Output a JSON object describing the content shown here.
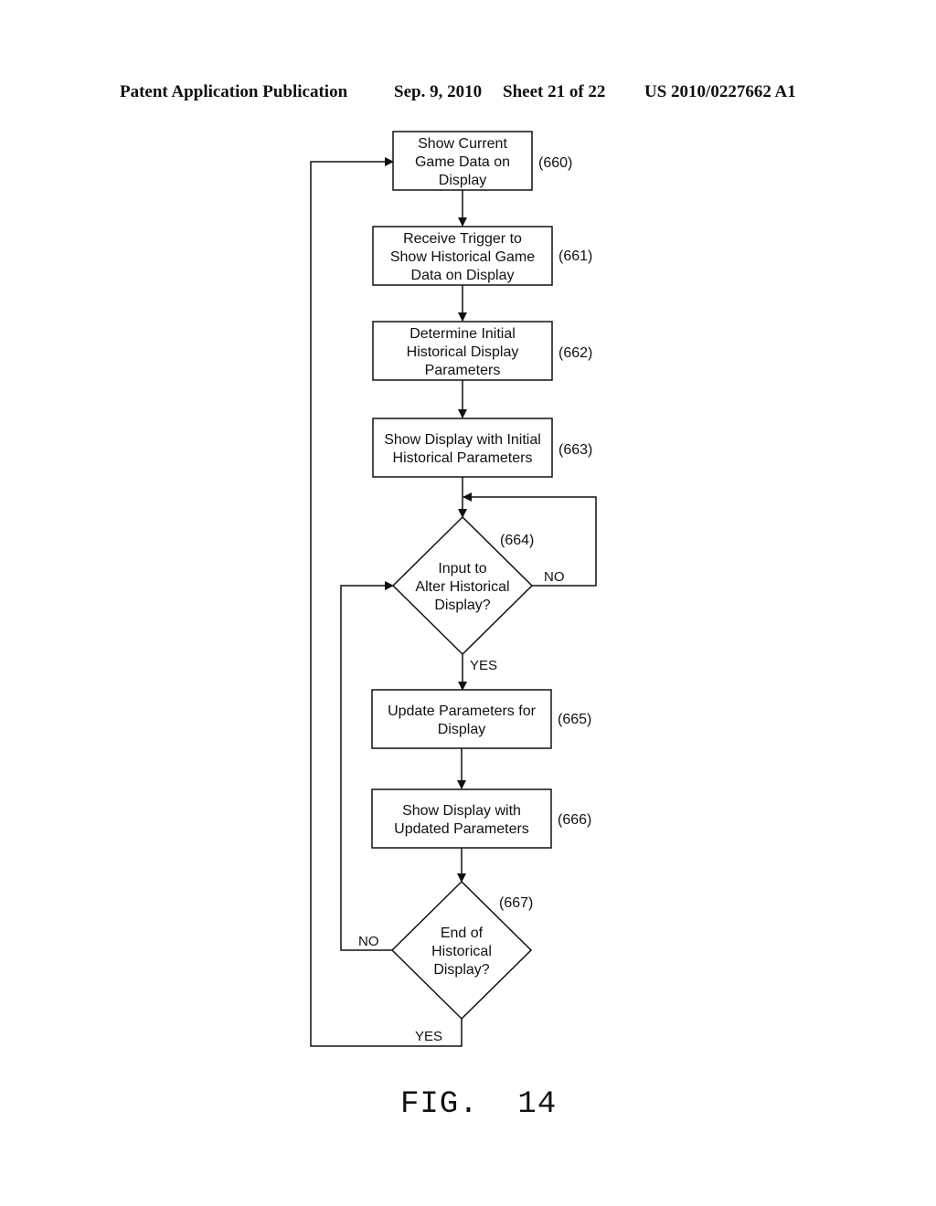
{
  "header": {
    "publication": "Patent Application Publication",
    "date": "Sep. 9, 2010",
    "sheet": "Sheet 21 of 22",
    "number": "US 2010/0227662 A1"
  },
  "figure_label": "FIG.  14",
  "nodes": [
    {
      "id": "660",
      "type": "process",
      "lines": [
        "Show Current",
        "Game Data on",
        "Display"
      ],
      "ref": "(660)"
    },
    {
      "id": "661",
      "type": "process",
      "lines": [
        "Receive Trigger to",
        "Show Historical Game",
        "Data on Display"
      ],
      "ref": "(661)"
    },
    {
      "id": "662",
      "type": "process",
      "lines": [
        "Determine Initial",
        "Historical Display",
        "Parameters"
      ],
      "ref": "(662)"
    },
    {
      "id": "663",
      "type": "process",
      "lines": [
        "Show Display with Initial",
        "Historical Parameters"
      ],
      "ref": "(663)"
    },
    {
      "id": "664",
      "type": "decision",
      "lines": [
        "Input to",
        "Alter Historical",
        "Display?"
      ],
      "ref": "(664)"
    },
    {
      "id": "665",
      "type": "process",
      "lines": [
        "Update Parameters for",
        "Display"
      ],
      "ref": "(665)"
    },
    {
      "id": "666",
      "type": "process",
      "lines": [
        "Show Display with",
        "Updated Parameters"
      ],
      "ref": "(666)"
    },
    {
      "id": "667",
      "type": "decision",
      "lines": [
        "End of",
        "Historical",
        "Display?"
      ],
      "ref": "(667)"
    }
  ],
  "edges": [
    {
      "from": "660",
      "to": "661",
      "label": ""
    },
    {
      "from": "661",
      "to": "662",
      "label": ""
    },
    {
      "from": "662",
      "to": "663",
      "label": ""
    },
    {
      "from": "663",
      "to": "664",
      "label": ""
    },
    {
      "from": "664",
      "to": "664",
      "label": "NO"
    },
    {
      "from": "664",
      "to": "665",
      "label": "YES"
    },
    {
      "from": "665",
      "to": "666",
      "label": ""
    },
    {
      "from": "666",
      "to": "667",
      "label": ""
    },
    {
      "from": "667",
      "to": "664",
      "label": "NO"
    },
    {
      "from": "667",
      "to": "660",
      "label": "YES"
    }
  ]
}
